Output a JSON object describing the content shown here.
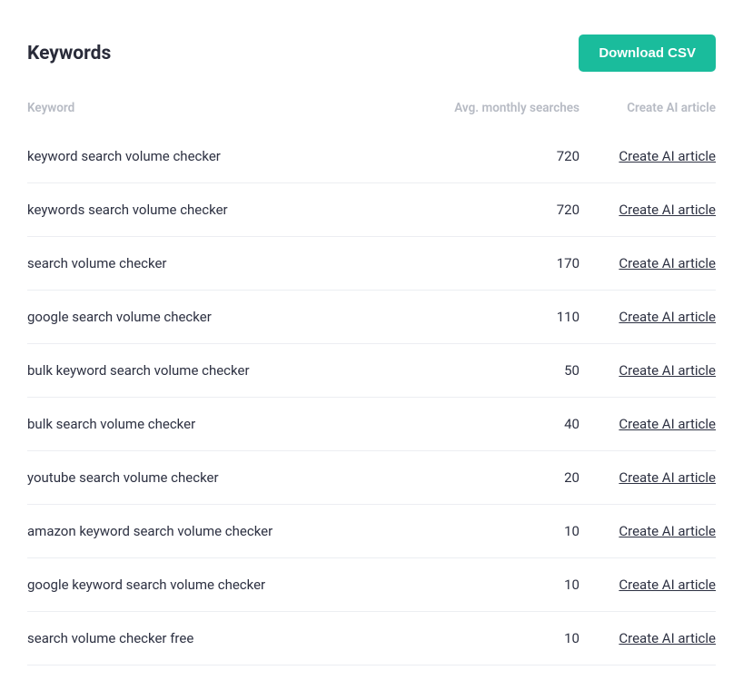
{
  "header": {
    "title": "Keywords",
    "download_label": "Download CSV"
  },
  "columns": {
    "keyword": "Keyword",
    "searches": "Avg. monthly searches",
    "action": "Create AI article"
  },
  "action_label": "Create AI article",
  "rows": [
    {
      "keyword": "keyword search volume checker",
      "searches": "720"
    },
    {
      "keyword": "keywords search volume checker",
      "searches": "720"
    },
    {
      "keyword": "search volume checker",
      "searches": "170"
    },
    {
      "keyword": "google search volume checker",
      "searches": "110"
    },
    {
      "keyword": "bulk keyword search volume checker",
      "searches": "50"
    },
    {
      "keyword": "bulk search volume checker",
      "searches": "40"
    },
    {
      "keyword": "youtube search volume checker",
      "searches": "20"
    },
    {
      "keyword": "amazon keyword search volume checker",
      "searches": "10"
    },
    {
      "keyword": "google keyword search volume checker",
      "searches": "10"
    },
    {
      "keyword": "search volume checker free",
      "searches": "10"
    }
  ]
}
